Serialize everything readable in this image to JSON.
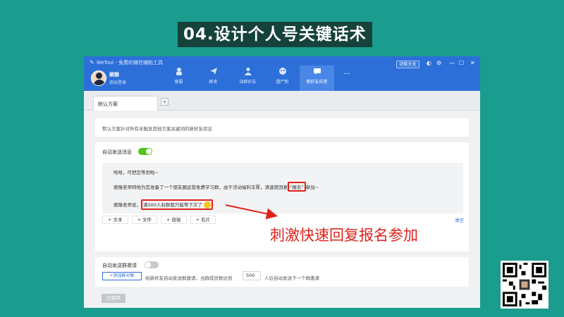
{
  "slide": {
    "title": "04.设计个人号关键话术"
  },
  "app": {
    "name": "WeTool - 免费的微信辅助工具",
    "user": {
      "name": "豌猴",
      "logout": "退出登录"
    },
    "nav": [
      {
        "label": "客服",
        "icon": "headset-icon"
      },
      {
        "label": "群发",
        "icon": "send-icon"
      },
      {
        "label": "加群好友",
        "icon": "add-friend-icon"
      },
      {
        "label": "僵尸粉",
        "icon": "zombie-icon"
      },
      {
        "label": "新好友应答",
        "icon": "chat-icon",
        "active": true
      }
    ],
    "nav_more": "···",
    "func_button": "功能大全",
    "tabs": [
      {
        "label": "默认方案"
      }
    ],
    "tab_add": "+",
    "note": "默认方案针对所有未触发其他方案关键词的新好友验证",
    "auto_send": {
      "label": "自动发送消息",
      "enabled": true
    },
    "message": {
      "line1": "哈哈，可把您等到啦~",
      "line2_before": "豌猴老师特地为您准备了一个朋友圈运营免费学习群，由于活动福利丰厚，请速度回复",
      "line2_highlight": "“报名”",
      "line2_after": "参加~",
      "line3_before": "豌猴老师说，",
      "line3_highlight": "满500人封群我只能等下次了",
      "line3_emoji": "crying-emoji"
    },
    "toolbar": [
      "+ 文本",
      "+ 文件",
      "+ 链接",
      "+ 名片"
    ],
    "clear": "清空",
    "group_invite": {
      "label": "自动发送群邀请",
      "enabled": false,
      "add_target": "+添加群对象",
      "desc_before": "给新好友自动发送群邀请，当群成员数达到",
      "threshold": "500",
      "desc_after": "人后自动发送下一个群邀请"
    },
    "save": "已保存"
  },
  "annotation": {
    "text": "刺激快速回复报名参加",
    "color": "#e0221b"
  },
  "colors": {
    "background": "#1a9c8f",
    "title_bar": "#2c6fd8",
    "title_box": "#16423c",
    "toggle_on": "#52c41a"
  }
}
